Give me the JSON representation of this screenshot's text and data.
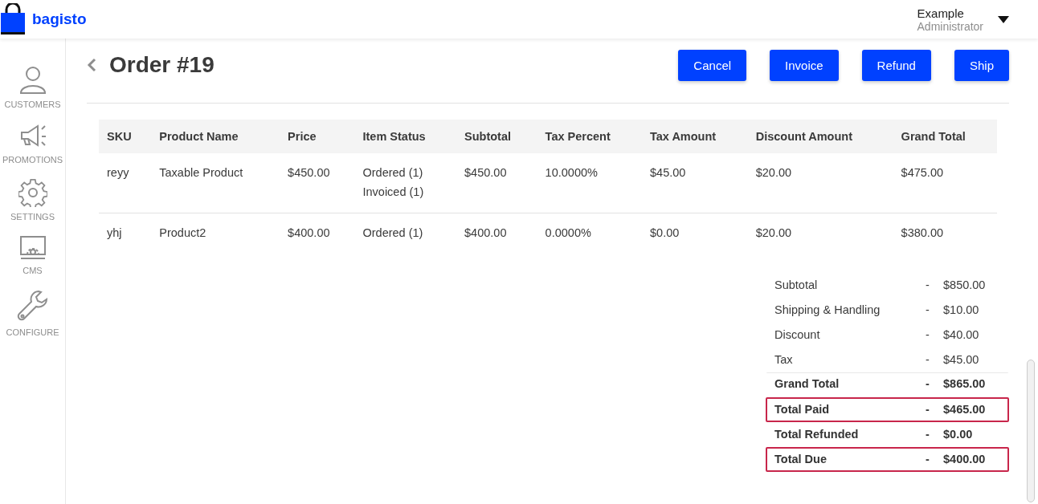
{
  "brand": "bagisto",
  "user": {
    "name": "Example",
    "role": "Administrator"
  },
  "sidebar": {
    "items": [
      {
        "label": "CUSTOMERS",
        "kind": "person"
      },
      {
        "label": "PROMOTIONS",
        "kind": "megaphone"
      },
      {
        "label": "SETTINGS",
        "kind": "gear"
      },
      {
        "label": "CMS",
        "kind": "monitor"
      },
      {
        "label": "CONFIGURE",
        "kind": "wrench"
      }
    ]
  },
  "page": {
    "title": "Order #19",
    "buttons": [
      "Cancel",
      "Invoice",
      "Refund",
      "Ship"
    ]
  },
  "table": {
    "columns": [
      "SKU",
      "Product Name",
      "Price",
      "Item Status",
      "Subtotal",
      "Tax Percent",
      "Tax Amount",
      "Discount Amount",
      "Grand Total"
    ],
    "rows": [
      [
        [
          "reyy"
        ],
        [
          "Taxable Product"
        ],
        [
          "$450.00"
        ],
        [
          "Ordered (1)",
          "Invoiced (1)"
        ],
        [
          "$450.00"
        ],
        [
          "10.0000%"
        ],
        [
          "$45.00"
        ],
        [
          "$20.00"
        ],
        [
          "$475.00"
        ]
      ],
      [
        [
          "yhj"
        ],
        [
          "Product2"
        ],
        [
          "$400.00"
        ],
        [
          "Ordered (1)"
        ],
        [
          "$400.00"
        ],
        [
          "0.0000%"
        ],
        [
          "$0.00"
        ],
        [
          "$20.00"
        ],
        [
          "$380.00"
        ]
      ]
    ]
  },
  "summary": [
    {
      "label": "Subtotal",
      "sep": "-",
      "value": "$850.00",
      "bold": false,
      "highlighted": false
    },
    {
      "label": "Shipping & Handling",
      "sep": "-",
      "value": "$10.00",
      "bold": false,
      "highlighted": false
    },
    {
      "label": "Discount",
      "sep": "-",
      "value": "$40.00",
      "bold": false,
      "highlighted": false
    },
    {
      "label": "Tax",
      "sep": "-",
      "value": "$45.00",
      "bold": false,
      "highlighted": false
    },
    {
      "label": "Grand Total",
      "sep": "-",
      "value": "$865.00",
      "bold": true,
      "highlighted": false
    },
    {
      "label": "Total Paid",
      "sep": "-",
      "value": "$465.00",
      "bold": true,
      "highlighted": true
    },
    {
      "label": "Total Refunded",
      "sep": "-",
      "value": "$0.00",
      "bold": true,
      "highlighted": false
    },
    {
      "label": "Total Due",
      "sep": "-",
      "value": "$400.00",
      "bold": true,
      "highlighted": true
    }
  ]
}
